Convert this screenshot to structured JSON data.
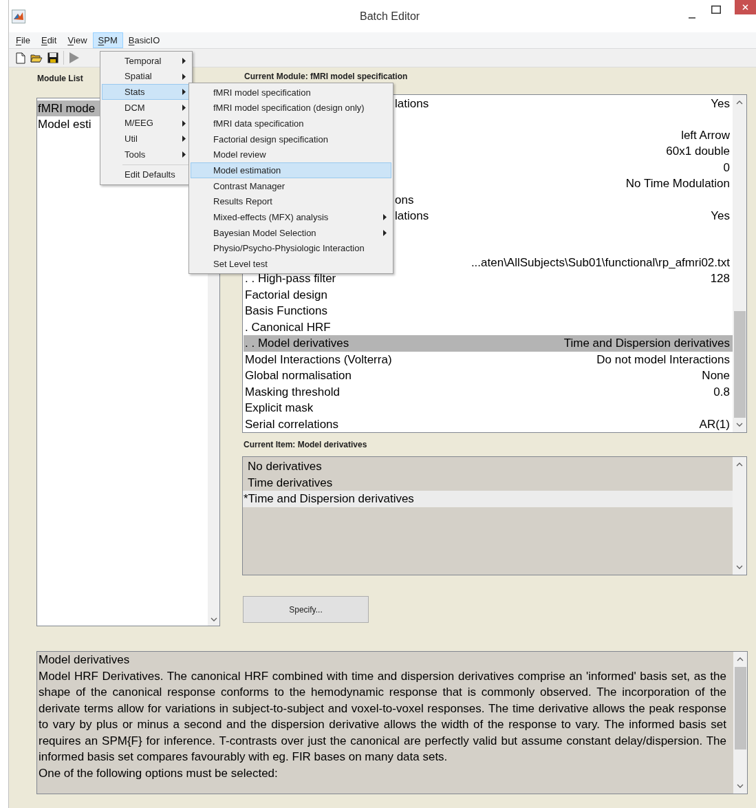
{
  "window": {
    "title": "Batch Editor"
  },
  "menu_bar": [
    {
      "label": "File",
      "selected": false
    },
    {
      "label": "Edit",
      "selected": false
    },
    {
      "label": "View",
      "selected": false
    },
    {
      "label": "SPM",
      "selected": true
    },
    {
      "label": "BasicIO",
      "selected": false
    }
  ],
  "module_list": {
    "title": "Module List",
    "items": [
      {
        "label": "fMRI mode",
        "selected": true
      },
      {
        "label": "Model esti",
        "selected": false
      }
    ]
  },
  "current_module": {
    "title": "Current Module: fMRI model specification",
    "rows": [
      {
        "label": "lations",
        "value": "Yes",
        "selected": false,
        "covered": true
      },
      {
        "label": "",
        "value": "",
        "selected": false
      },
      {
        "label": "",
        "value": "left Arrow",
        "selected": false
      },
      {
        "label": "",
        "value": "60x1 double",
        "selected": false
      },
      {
        "label": "",
        "value": "0",
        "selected": false
      },
      {
        "label": "",
        "value": "No Time Modulation",
        "selected": false
      },
      {
        "label": "ons",
        "value": "",
        "selected": false,
        "covered": true
      },
      {
        "label": "lations",
        "value": "Yes",
        "selected": false,
        "covered": true
      },
      {
        "label": "",
        "value": "",
        "selected": false
      },
      {
        "label": "",
        "value": "",
        "selected": false
      },
      {
        "label": "",
        "value": "...aten\\AllSubjects\\Sub01\\functional\\rp_afmri02.txt",
        "selected": false
      },
      {
        "label": ". . High-pass filter",
        "value": "128",
        "selected": false,
        "covered": false
      },
      {
        "label": "Factorial design",
        "value": "",
        "selected": false,
        "covered": false
      },
      {
        "label": "Basis Functions",
        "value": "",
        "selected": false,
        "covered": false
      },
      {
        "label": ". Canonical HRF",
        "value": "",
        "selected": false,
        "covered": false
      },
      {
        "label": ". . Model derivatives",
        "value": "Time and Dispersion derivatives",
        "selected": true,
        "covered": false
      },
      {
        "label": "Model Interactions (Volterra)",
        "value": "Do not model Interactions",
        "selected": false,
        "covered": false
      },
      {
        "label": "Global normalisation",
        "value": "None",
        "selected": false,
        "covered": false
      },
      {
        "label": "Masking threshold",
        "value": "0.8",
        "selected": false,
        "covered": false
      },
      {
        "label": "Explicit mask",
        "value": "",
        "selected": false,
        "covered": false
      },
      {
        "label": "Serial correlations",
        "value": "AR(1)",
        "selected": false,
        "covered": false
      }
    ]
  },
  "current_item": {
    "title": "Current Item: Model derivatives",
    "options": [
      {
        "label": "No derivatives",
        "selected": false
      },
      {
        "label": "Time derivatives",
        "selected": false
      },
      {
        "label": "*Time and Dispersion derivatives",
        "selected": true
      }
    ]
  },
  "specify_button": "Specify...",
  "help": {
    "title": "Model derivatives",
    "text": "Model HRF Derivatives. The canonical HRF combined with time and dispersion derivatives comprise an 'informed' basis set, as the shape of the canonical response conforms to the hemodynamic response that is commonly observed. The incorporation of the derivate terms allow for variations in subject-to-subject and voxel-to-voxel responses. The time derivative allows the peak response to vary by plus or minus a second and the dispersion derivative allows the width of the response to vary. The informed basis set requires an SPM{F} for inference. T-contrasts over just the canonical are perfectly valid but assume constant delay/dispersion. The informed basis set compares favourably with eg. FIR bases on many data sets.",
    "footer": "One of the following options must be selected:"
  },
  "spm_menu": {
    "items": [
      {
        "label": "Temporal",
        "submenu": true,
        "selected": false
      },
      {
        "label": "Spatial",
        "submenu": true,
        "selected": false
      },
      {
        "label": "Stats",
        "submenu": true,
        "selected": true
      },
      {
        "label": "DCM",
        "submenu": true,
        "selected": false
      },
      {
        "label": "M/EEG",
        "submenu": true,
        "selected": false
      },
      {
        "label": "Util",
        "submenu": true,
        "selected": false
      },
      {
        "label": "Tools",
        "submenu": true,
        "selected": false
      }
    ],
    "footer_items": [
      {
        "label": "Edit Defaults",
        "submenu": false,
        "selected": false
      }
    ]
  },
  "stats_menu": {
    "items": [
      {
        "label": "fMRI model specification",
        "submenu": false,
        "selected": false
      },
      {
        "label": "fMRI model specification (design only)",
        "submenu": false,
        "selected": false
      },
      {
        "label": "fMRI data specification",
        "submenu": false,
        "selected": false
      },
      {
        "label": "Factorial design specification",
        "submenu": false,
        "selected": false
      },
      {
        "label": "Model review",
        "submenu": false,
        "selected": false
      },
      {
        "label": "Model estimation",
        "submenu": false,
        "selected": true
      },
      {
        "label": "Contrast Manager",
        "submenu": false,
        "selected": false
      },
      {
        "label": "Results Report",
        "submenu": false,
        "selected": false
      },
      {
        "label": "Mixed-effects (MFX) analysis",
        "submenu": true,
        "selected": false
      },
      {
        "label": "Bayesian Model Selection",
        "submenu": true,
        "selected": false
      },
      {
        "label": "Physio/Psycho-Physiologic Interaction",
        "submenu": false,
        "selected": false
      },
      {
        "label": "Set Level test",
        "submenu": false,
        "selected": false
      }
    ]
  }
}
